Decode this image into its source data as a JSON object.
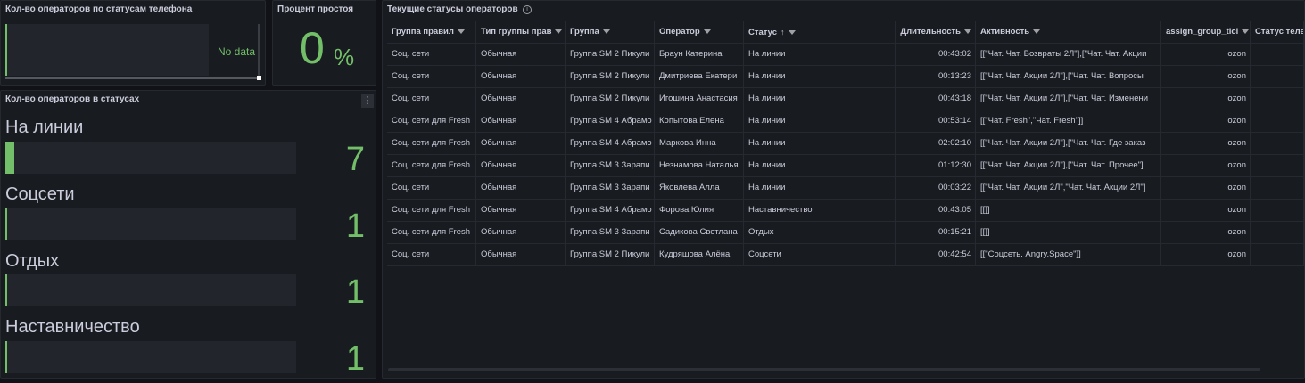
{
  "panel_phone": {
    "title": "Кол-во операторов по статусам телефона",
    "no_data": "No data"
  },
  "panel_idle": {
    "title": "Процент простоя",
    "value": "0",
    "unit": "%"
  },
  "panel_statuses": {
    "title": "Кол-во операторов в статусах",
    "menu": "⋮",
    "items": [
      {
        "label": "На линии",
        "value": "7",
        "fill": 0.03
      },
      {
        "label": "Соцсети",
        "value": "1",
        "fill": 0.0
      },
      {
        "label": "Отдых",
        "value": "1",
        "fill": 0.0
      },
      {
        "label": "Наставничество",
        "value": "1",
        "fill": 0.0
      }
    ]
  },
  "table": {
    "title": "Текущие статусы операторов",
    "info": "i",
    "headers": [
      "Группа правил",
      "Тип группы прав",
      "Группа",
      "Оператор",
      "Статус",
      "Длительность",
      "Активность",
      "assign_group_ticl",
      "Статус теле"
    ],
    "rows": [
      [
        "Соц. сети",
        "Обычная",
        "Группа SM 2 Пикули",
        "Браун Катерина",
        "На линии",
        "00:43:02",
        "[[\"Чат. Чат. Возвраты 2Л\"],[\"Чат. Чат. Акции",
        "ozon",
        ""
      ],
      [
        "Соц. сети",
        "Обычная",
        "Группа SM 2 Пикули",
        "Дмитриева Екатери",
        "На линии",
        "00:13:23",
        "[[\"Чат. Чат. Акции 2Л\"],[\"Чат. Чат. Вопросы",
        "ozon",
        ""
      ],
      [
        "Соц. сети",
        "Обычная",
        "Группа SM 2 Пикули",
        "Игошина Анастасия",
        "На линии",
        "00:43:18",
        "[[\"Чат. Чат. Акции 2Л\"],[\"Чат. Чат. Изменени",
        "ozon",
        ""
      ],
      [
        "Соц. сети для Fresh",
        "Обычная",
        "Группа SM 4 Абрамо",
        "Копытова Елена",
        "На линии",
        "00:53:14",
        "[[\"Чат. Fresh\",\"Чат. Fresh\"]]",
        "ozon",
        ""
      ],
      [
        "Соц. сети для Fresh",
        "Обычная",
        "Группа SM 4 Абрамо",
        "Маркова Инна",
        "На линии",
        "02:02:10",
        "[[\"Чат. Чат. Акции 2Л\"],[\"Чат. Чат. Где заказ",
        "ozon",
        ""
      ],
      [
        "Соц. сети для Fresh",
        "Обычная",
        "Группа SM 3 Зарапи",
        "Незнамова Наталья",
        "На линии",
        "01:12:30",
        "[[\"Чат. Чат. Акции 2Л\"],[\"Чат. Чат. Прочее\"]",
        "ozon",
        ""
      ],
      [
        "Соц. сети",
        "Обычная",
        "Группа SM 3 Зарапи",
        "Яковлева Алла",
        "На линии",
        "00:03:22",
        "[[\"Чат. Чат. Акции 2Л\",\"Чат. Чат. Акции 2Л\"]",
        "ozon",
        ""
      ],
      [
        "Соц. сети для Fresh",
        "Обычная",
        "Группа SM 4 Абрамо",
        "Форова Юлия",
        "Наставничество",
        "00:43:05",
        "[[]]",
        "ozon",
        ""
      ],
      [
        "Соц. сети для Fresh",
        "Обычная",
        "Группа SM 3 Зарапи",
        "Садикова Светлана",
        "Отдых",
        "00:15:21",
        "[[]]",
        "ozon",
        ""
      ],
      [
        "Соц. сети",
        "Обычная",
        "Группа SM 2 Пикули",
        "Кудряшова Алёна",
        "Соцсети",
        "00:42:54",
        "[[\"Соцсеть. Angry.Space\"]]",
        "ozon",
        ""
      ]
    ]
  },
  "colors": {
    "accent": "#73bf69",
    "background": "#111217",
    "panel": "#181b1f"
  }
}
